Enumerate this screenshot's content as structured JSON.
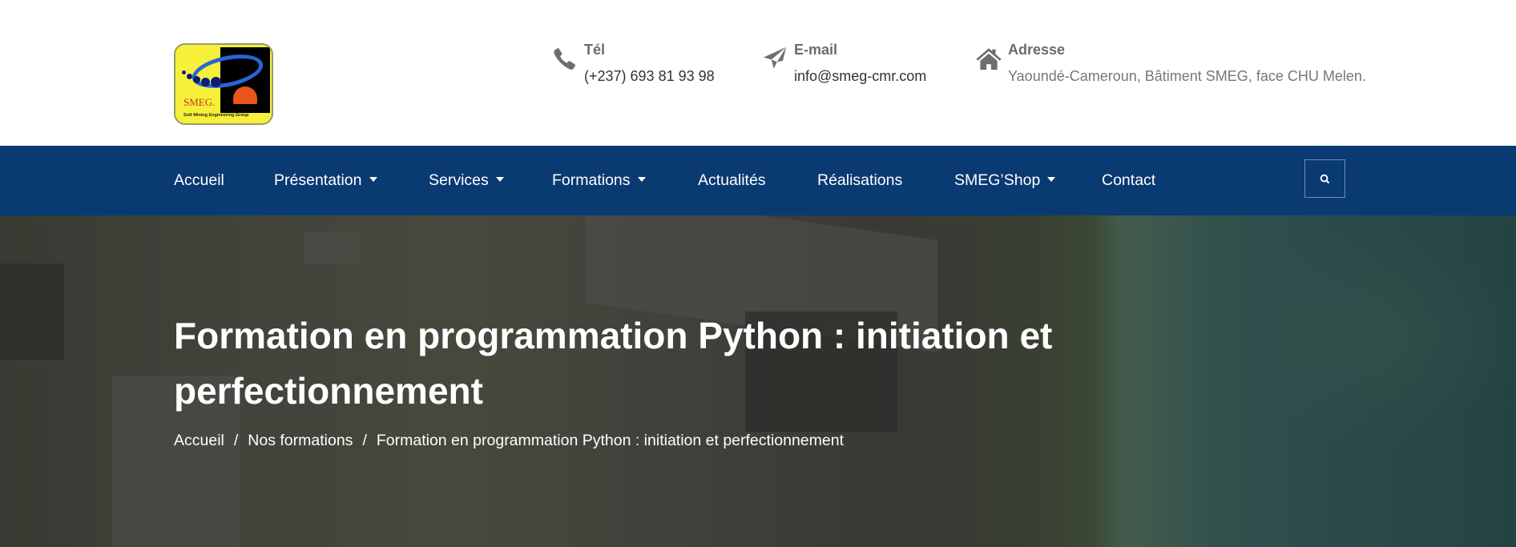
{
  "logo": {
    "title": "SMEG.",
    "subtitle": "Soft Mining Engineering Group"
  },
  "contacts": [
    {
      "icon": "phone-icon",
      "label": "Tél",
      "value": "(+237) 693 81 93 98"
    },
    {
      "icon": "paper-plane-icon",
      "label": "E-mail",
      "value": "info@smeg-cmr.com"
    },
    {
      "icon": "home-icon",
      "label": "Adresse",
      "value": "Yaoundé-Cameroun, Bâtiment SMEG, face CHU Melen."
    }
  ],
  "nav": {
    "items": [
      {
        "label": "Accueil",
        "dropdown": false
      },
      {
        "label": "Présentation",
        "dropdown": true
      },
      {
        "label": "Services",
        "dropdown": true
      },
      {
        "label": "Formations",
        "dropdown": true
      },
      {
        "label": "Actualités",
        "dropdown": false
      },
      {
        "label": "Réalisations",
        "dropdown": false
      },
      {
        "label": "SMEG’Shop",
        "dropdown": true
      },
      {
        "label": "Contact",
        "dropdown": false
      }
    ],
    "search_icon": "search-icon"
  },
  "hero": {
    "title": "Formation en programmation Python : initiation et perfectionnement",
    "breadcrumb": [
      "Accueil",
      "Nos formations",
      "Formation en programmation Python : initiation et perfectionnement"
    ],
    "separator": "/"
  },
  "colors": {
    "nav": "#0a3a72"
  }
}
